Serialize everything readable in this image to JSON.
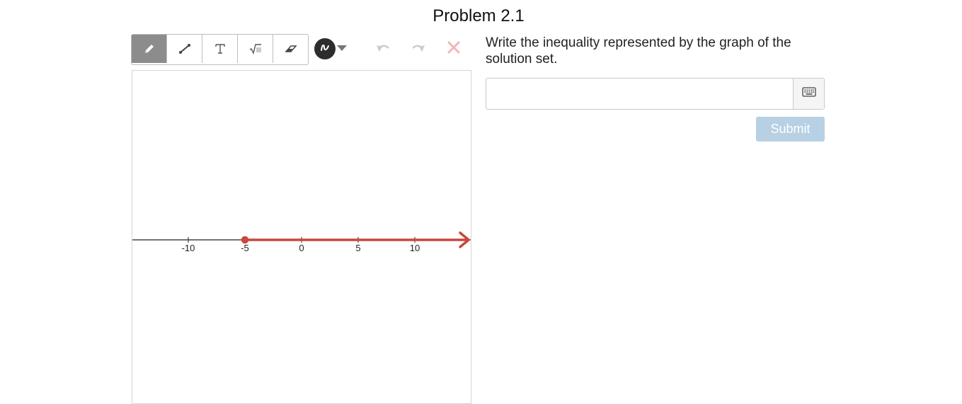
{
  "problem": {
    "title": "Problem 2.1"
  },
  "toolbar": {
    "tools": [
      {
        "name": "pencil",
        "icon": "pencil-icon",
        "active": true
      },
      {
        "name": "line",
        "icon": "line-segment-icon",
        "active": false
      },
      {
        "name": "text",
        "icon": "text-T-icon",
        "label": "T",
        "active": false
      },
      {
        "name": "math",
        "icon": "square-root-icon",
        "label": "√",
        "active": false
      },
      {
        "name": "eraser",
        "icon": "eraser-icon",
        "active": false
      }
    ],
    "color_picker": {
      "icon": "squiggle-icon",
      "color": "#2d2d2d",
      "caret_icon": "caret-down-icon"
    },
    "undo_icon": "undo-icon",
    "redo_icon": "redo-icon",
    "clear_icon": "close-icon",
    "disabled_color": "#cccccc",
    "clear_color": "#f2b6b6"
  },
  "number_line": {
    "ticks": [
      -10,
      -5,
      0,
      5,
      10
    ],
    "tick_labels": [
      "-10",
      "-5",
      "0",
      "5",
      "10"
    ],
    "solution": {
      "start": -5,
      "closed": true,
      "direction": "right",
      "color": "#c8473e"
    },
    "axis_color": "#222222"
  },
  "question": {
    "prompt": "Write the inequality represented by the graph of the solution set.",
    "answer_value": "",
    "keyboard_icon": "keyboard-icon",
    "submit_label": "Submit",
    "submit_color": "#b7d0e3"
  }
}
